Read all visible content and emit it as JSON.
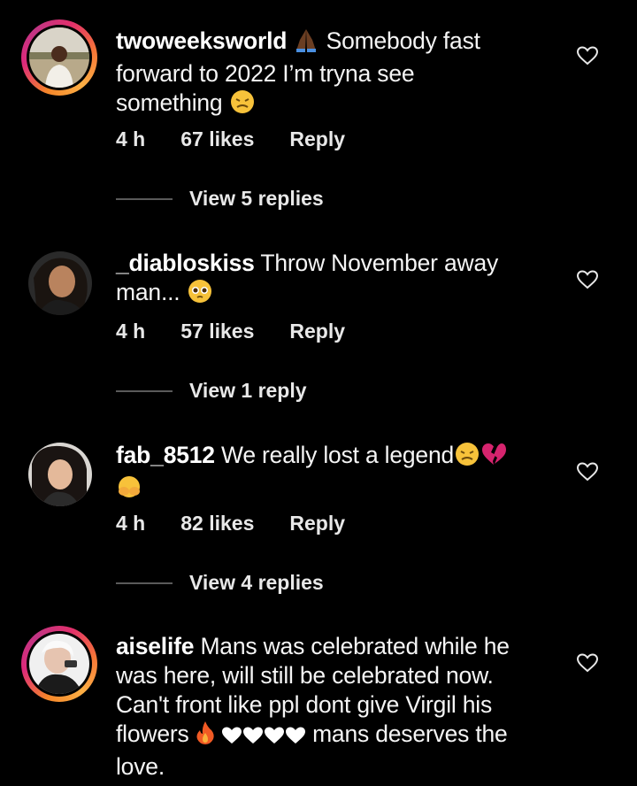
{
  "comments": [
    {
      "username": "twoweeksworld",
      "prefix_emoji_icon": "folded-hands-dark-emoji",
      "text_lines": [
        "Somebody fast",
        "forward to 2022 I’m tryna see",
        "something"
      ],
      "suffix_emoji_icon": "persevering-face-emoji",
      "time": "4 h",
      "likes": "67 likes",
      "reply_label": "Reply",
      "view_replies": "View 5 replies"
    },
    {
      "username": "_diabloskiss",
      "text_lines": [
        "Throw November away",
        "man..."
      ],
      "suffix_emoji_icon": "pleading-face-emoji",
      "time": "4 h",
      "likes": "57 likes",
      "reply_label": "Reply",
      "view_replies": "View 1 reply"
    },
    {
      "username": "fab_8512",
      "text_lines": [
        "We really lost a legend"
      ],
      "suffix_emoji_icons": [
        "persevering-face-emoji",
        "broken-heart-emoji",
        "face-in-hands-emoji"
      ],
      "time": "4 h",
      "likes": "82 likes",
      "reply_label": "Reply",
      "view_replies": "View 4 replies"
    },
    {
      "username": "aiselife",
      "text_lines": [
        "Mans was celebrated while he",
        "was here, will still be celebrated now.",
        "Can't front like ppl dont give Virgil his",
        "flowers",
        "mans deserves the",
        "love."
      ],
      "inline_icons": [
        "fire-emoji",
        "white-heart-emoji",
        "white-heart-emoji",
        "white-heart-emoji",
        "white-heart-emoji"
      ]
    }
  ],
  "colors": {
    "background": "#000000",
    "text": "#f5f5f5",
    "meta": "#e8e8e8",
    "divider": "#5a5a5a"
  }
}
